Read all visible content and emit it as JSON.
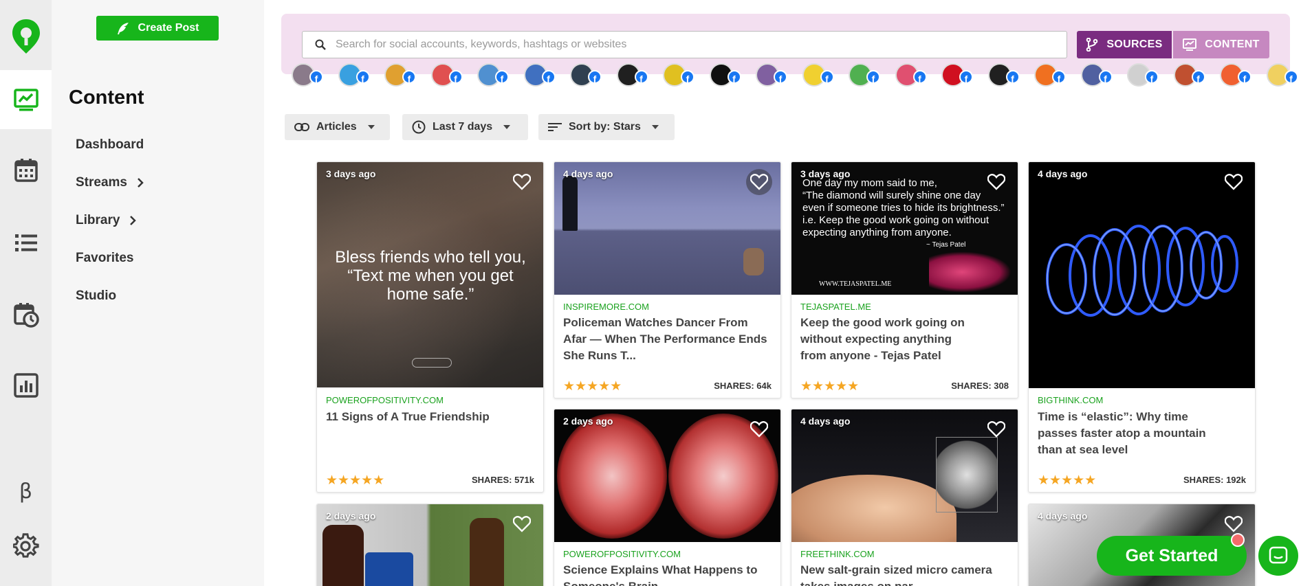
{
  "colors": {
    "brand_green": "#17b51b",
    "sources_purple": "#7a2c80",
    "content_pink": "#c688c0",
    "search_band": "#f3dff0",
    "source_green": "#1aa21e",
    "star": "#f5a623"
  },
  "rail": {
    "logo": "map-pin-logo-icon",
    "items": [
      {
        "icon": "content-chart-icon",
        "active": true
      },
      {
        "icon": "calendar-icon"
      },
      {
        "icon": "list-icon"
      },
      {
        "icon": "calendar-clock-icon"
      },
      {
        "icon": "analytics-icon"
      },
      {
        "icon": "beta-icon",
        "label": "β"
      },
      {
        "icon": "gear-icon"
      }
    ]
  },
  "sidenav": {
    "create_label": "Create Post",
    "title": "Content",
    "items": [
      {
        "label": "Dashboard"
      },
      {
        "label": "Streams",
        "chevron": true
      },
      {
        "label": "Library",
        "chevron": true
      },
      {
        "label": "Favorites"
      },
      {
        "label": "Studio"
      }
    ]
  },
  "search": {
    "placeholder": "Search for social accounts, keywords, hashtags or websites",
    "sources_label": "SOURCES",
    "content_label": "CONTENT"
  },
  "avatar_colors": [
    "#8a7a8a",
    "#39a0e0",
    "#e0a030",
    "#e05050",
    "#5090d0",
    "#4070c0",
    "#304050",
    "#202020",
    "#e0c020",
    "#101010",
    "#8060a0",
    "#f0d030",
    "#50b050",
    "#e05070",
    "#d01020",
    "#202020",
    "#f07020",
    "#5060a0",
    "#d0d0d0",
    "#c05030",
    "#f06030",
    "#f0d060"
  ],
  "filters": {
    "type": "Articles",
    "range": "Last 7 days",
    "sort": "Sort by: Stars"
  },
  "cards": [
    {
      "age": "3 days ago",
      "source": "POWEROFPOSITIVITY.COM",
      "title": "11 Signs of A True Friendship",
      "shares": "SHARES: 571k",
      "stars": "★★★★★",
      "quote": "Bless friends who tell you, “Text me when you get home safe.”"
    },
    {
      "age": "4 days ago",
      "source": "INSPIREMORE.COM",
      "title": "Policeman Watches Dancer From Afar — When The Performance Ends She Runs T...",
      "shares": "SHARES: 64k",
      "stars": "★★★★★"
    },
    {
      "age": "3 days ago",
      "source": "TEJASPATEL.ME",
      "title": "Keep the good work going on without expecting anything from anyone - Tejas Patel",
      "shares": "SHARES: 308",
      "stars": "★★★★★",
      "quote_lines": [
        "One day my mom said to me,",
        "“The diamond will surely shine one day",
        "even if someone tries to hide its brightness.”",
        "i.e. Keep the good work going on without",
        "expecting anything from anyone."
      ],
      "quote_author": "~ Tejas Patel",
      "quote_site": "WWW.TEJASPATEL.ME"
    },
    {
      "age": "4 days ago",
      "source": "BIGTHINK.COM",
      "title": "Time is “elastic”: Why time passes faster atop a mountain than at sea level",
      "shares": "SHARES: 192k",
      "stars": "★★★★★"
    },
    {
      "age": "2 days ago",
      "source": "POWEROFPOSITIVITY.COM",
      "title": "Science Explains What Happens to Someone's Brain"
    },
    {
      "age": "4 days ago",
      "source": "FREETHINK.COM",
      "title": "New salt-grain sized micro camera takes images on par"
    },
    {
      "age": "2 days ago"
    },
    {
      "age": "4 days ago"
    }
  ],
  "cta": {
    "get_started": "Get Started"
  }
}
